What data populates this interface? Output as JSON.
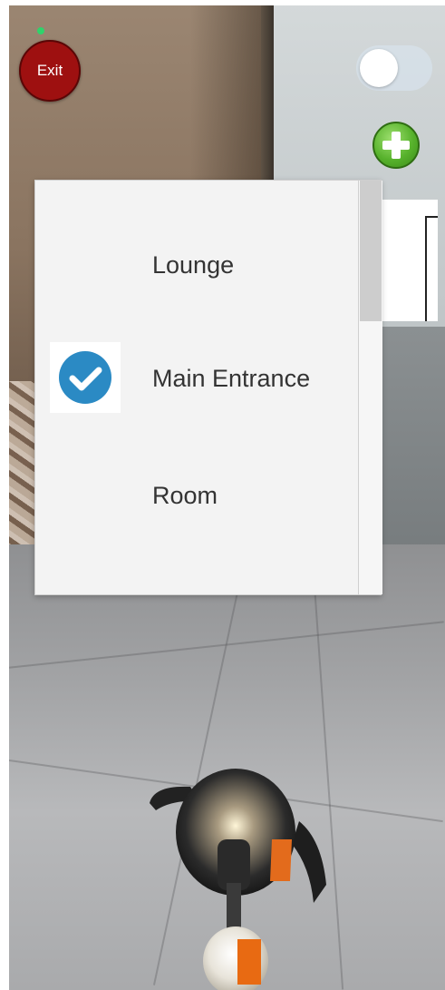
{
  "header": {
    "exit_label": "Exit",
    "status_color": "#2fd36b",
    "exit_color": "#9e1010",
    "add_button_color": "#57b22c",
    "toggle_on": false
  },
  "location_list": {
    "items": [
      {
        "label": "Lounge",
        "selected": false
      },
      {
        "label": "Main Entrance",
        "selected": true
      },
      {
        "label": "Room",
        "selected": false
      }
    ],
    "check_color": "#2b8ac4"
  },
  "icons": {
    "exit": "exit-button",
    "add": "plus-circle-icon",
    "check": "check-circle-icon",
    "toggle": "toggle-switch"
  }
}
